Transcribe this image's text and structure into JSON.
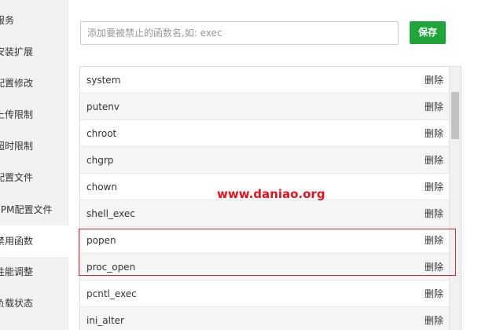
{
  "sidebar": {
    "items": [
      {
        "label": "服务",
        "active": false
      },
      {
        "label": "安装扩展",
        "active": false
      },
      {
        "label": "配置修改",
        "active": false
      },
      {
        "label": "上传限制",
        "active": false
      },
      {
        "label": "超时限制",
        "active": false
      },
      {
        "label": "配置文件",
        "active": false
      },
      {
        "label": "FPM配置文件",
        "active": false
      },
      {
        "label": "禁用函数",
        "active": true
      },
      {
        "label": "性能调整",
        "active": false
      },
      {
        "label": "负载状态",
        "active": false
      }
    ]
  },
  "form": {
    "input_value": "",
    "input_placeholder": "添加要被禁止的函数名,如: exec",
    "save_label": "保存"
  },
  "functions": {
    "delete_label": "删除",
    "rows": [
      {
        "name": "system"
      },
      {
        "name": "putenv"
      },
      {
        "name": "chroot"
      },
      {
        "name": "chgrp"
      },
      {
        "name": "chown"
      },
      {
        "name": "shell_exec"
      },
      {
        "name": "popen"
      },
      {
        "name": "proc_open"
      },
      {
        "name": "pcntl_exec"
      },
      {
        "name": "ini_alter"
      }
    ]
  },
  "watermark": "www.daniao.org",
  "colors": {
    "save_button": "#20a53a",
    "watermark": "#e5121d",
    "highlight_box": "#e0232b"
  }
}
